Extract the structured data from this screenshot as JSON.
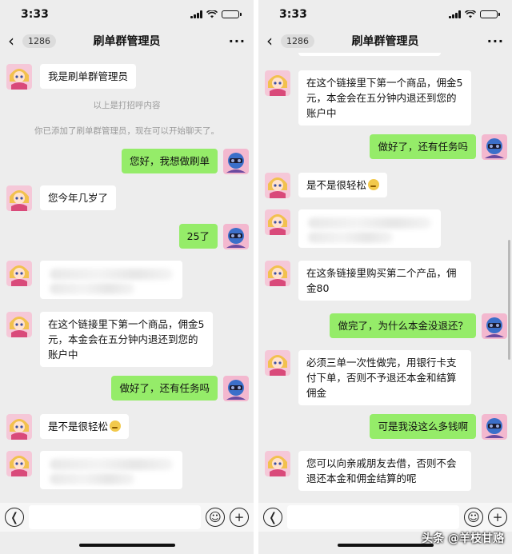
{
  "status": {
    "time": "3:33"
  },
  "header": {
    "unread_count": "1286",
    "title": "刷单群管理员"
  },
  "left": {
    "intro_message": "我是刷单群管理员",
    "system_greeting": "以上是打招呼内容",
    "system_added": "你已添加了刷单群管理员，现在可以开始聊天了。",
    "out_1": "您好，我想做刷单",
    "in_age": "您今年几岁了",
    "out_age": "25了",
    "in_link": "在这个链接里下第一个商品，佣金5元，本金会在五分钟内退还到您的账户中",
    "out_done": "做好了，还有任务吗",
    "in_easy": "是不是很轻松"
  },
  "right": {
    "in_link": "在这个链接里下第一个商品，佣金5元，本金会在五分钟内退还到您的账户中",
    "out_done": "做好了，还有任务吗",
    "in_easy": "是不是很轻松",
    "in_second": "在这条链接里购买第二个产品，佣金80",
    "out_why": "做完了，为什么本金没退还？",
    "in_three": "必须三单一次性做完，用银行卡支付下单，否则不予退还本金和结算佣金",
    "out_money": "可是我没这么多钱啊",
    "in_borrow": "您可以向亲戚朋友去借，否则不会退还本金和佣金结算的呢"
  },
  "icons": {
    "back": "chevron-left-icon",
    "more": "more-icon",
    "voice": "voice-icon",
    "emoji": "emoji-icon",
    "plus": "plus-icon"
  },
  "colors": {
    "out_bubble": "#95ec69",
    "background": "#ededed"
  },
  "watermark": "头条 @羊枝甘赂"
}
